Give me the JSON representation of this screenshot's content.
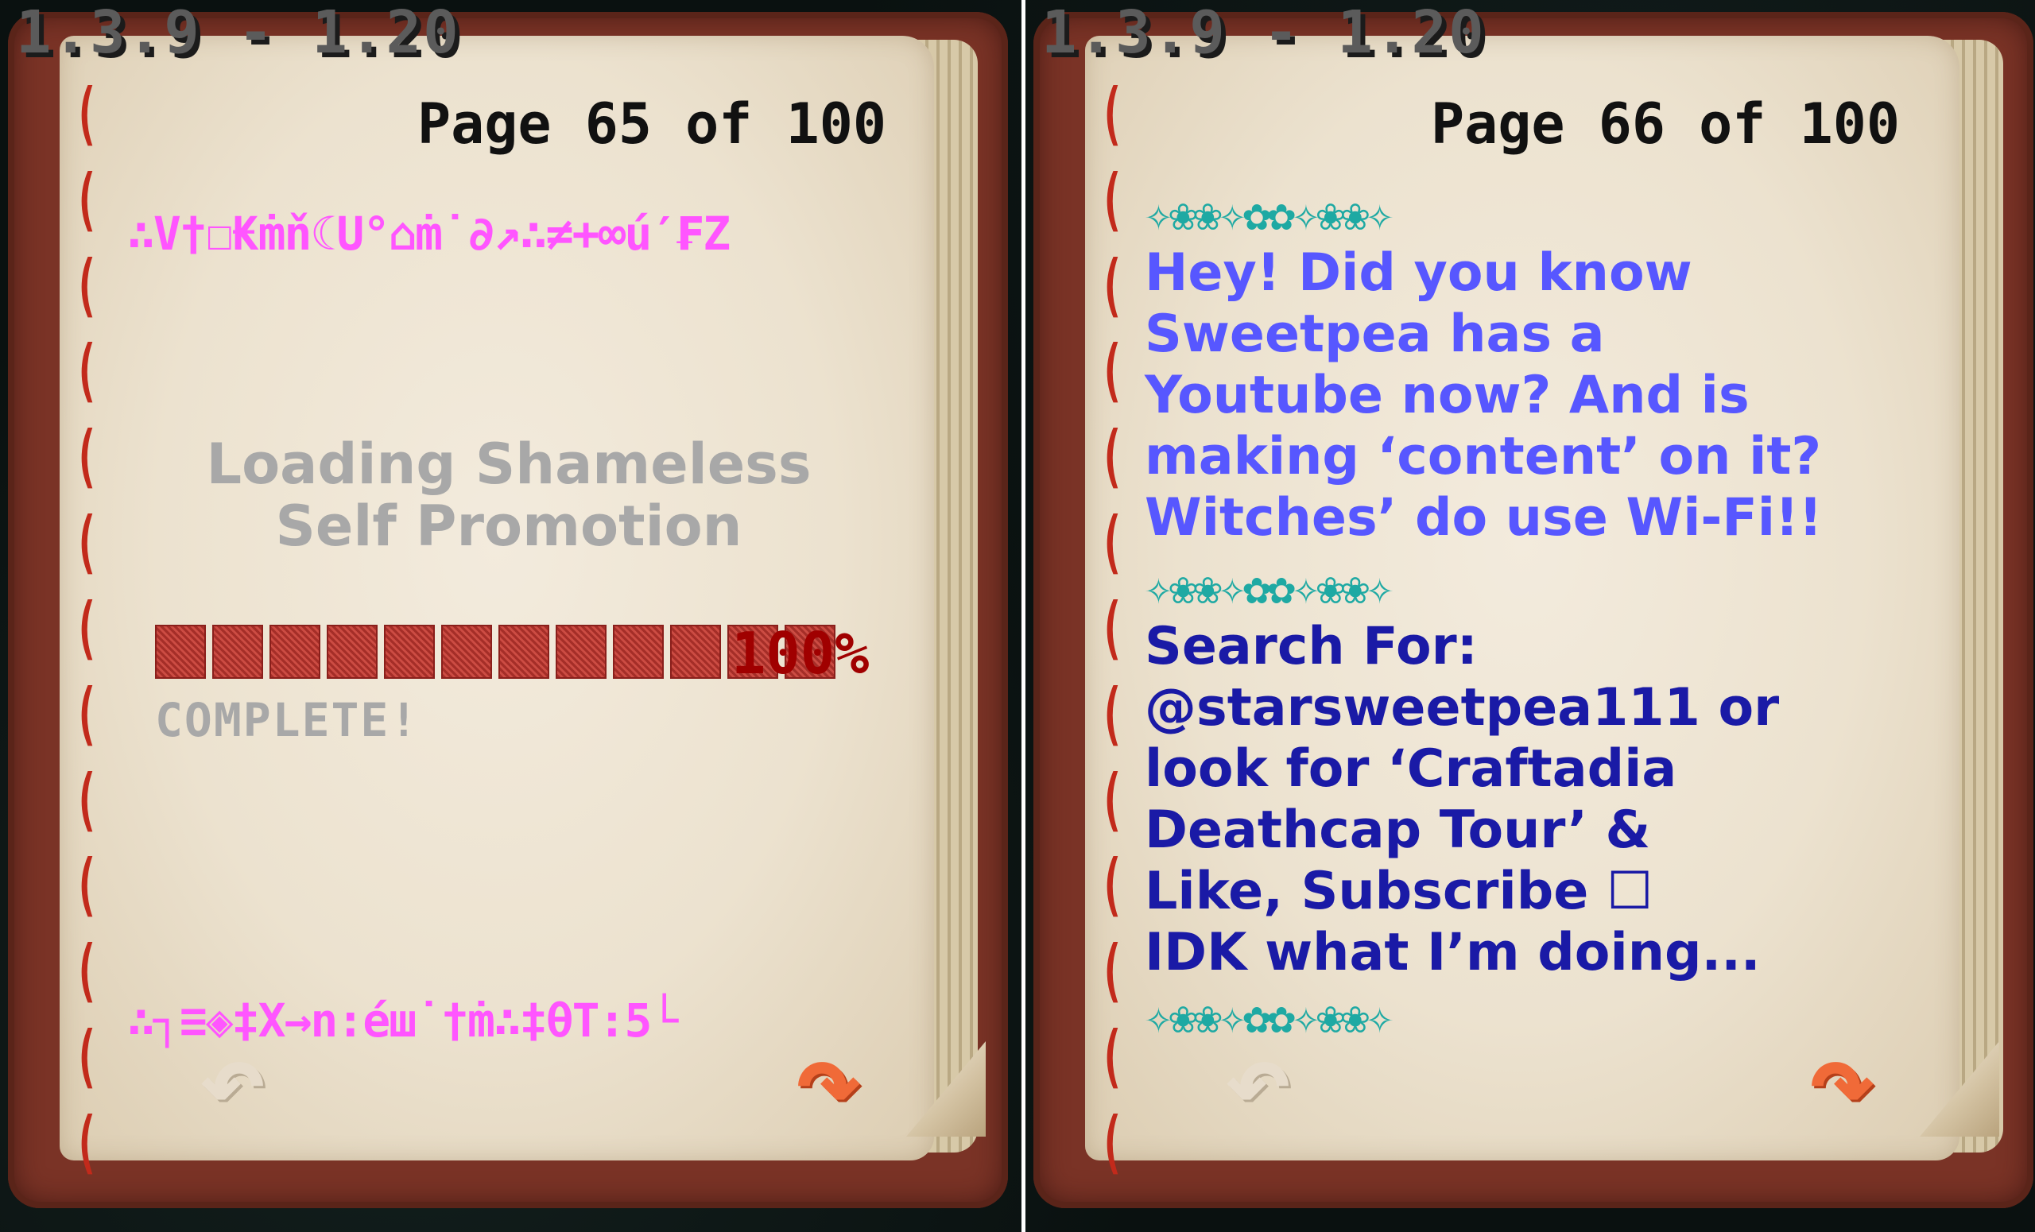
{
  "version_label": "1.3.9 - 1.20",
  "left_page": {
    "page_number": "Page 65 of 100",
    "glitch_top": "∴V†☐₭ṁň☾U°⌂ṁ˙∂↗∴≠+∞ú′₣Z",
    "loading_line1": "Loading Shameless",
    "loading_line2": "Self Promotion",
    "progress_percent": "100%",
    "progress_fraction": 1.0,
    "complete_label": "COMPLETE!",
    "glitch_bottom": "∴┐≡◈‡X→n:éш˙†ṁ∴‡θT:5└"
  },
  "right_page": {
    "page_number": "Page 66 of 100",
    "divider": "✧❀❀✧✿✿✧❀❀✧",
    "promo_lines": [
      "Hey! Did you know",
      "Sweetpea has a",
      "Youtube now? And is",
      "making ‘content’ on it?",
      "Witches’ do use Wi-Fi!!"
    ],
    "search_lines": [
      "Search For:",
      "@starsweetpea111 or",
      "look for ‘Craftadia",
      "Deathcap Tour’ &",
      "Like, Subscribe ☐",
      "IDK what I’m doing..."
    ]
  },
  "icons": {
    "back": "curved-arrow-back-icon",
    "next": "curved-arrow-next-icon"
  },
  "colors": {
    "glitch": "#ff55ff",
    "loading_text": "#a8a8a8",
    "progress_red": "#a00000",
    "promo_blue": "#5757ff",
    "search_blue": "#1a1aa6",
    "deco_teal": "#1ea9a3",
    "cover": "#7a3326",
    "next_arrow": "#f06a38"
  }
}
